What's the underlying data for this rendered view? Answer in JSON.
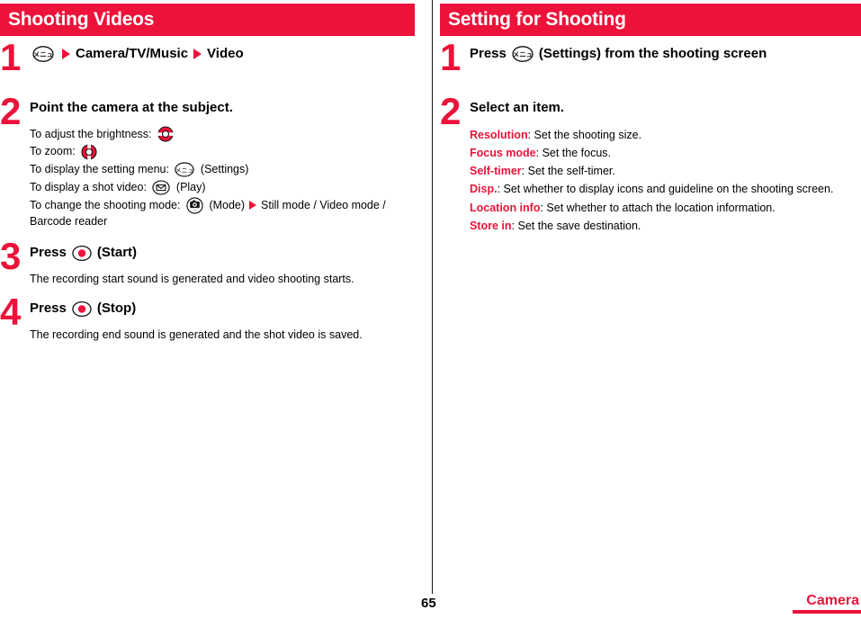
{
  "theme": {
    "accent": "#ec1239",
    "text": "#000000",
    "header_text": "#ffffff"
  },
  "left": {
    "header": "Shooting Videos",
    "step1": {
      "number": "1",
      "icon": "menu-key-icon",
      "sep": "▶",
      "text_a": "Camera/TV/Music",
      "text_b": "Video"
    },
    "step2": {
      "number": "2",
      "title": "Point the camera at the subject.",
      "lines": [
        {
          "label": "To adjust the brightness: ",
          "icon": "updown-key-icon",
          "suffix": ""
        },
        {
          "label": "To zoom: ",
          "icon": "leftright-key-icon",
          "suffix": ""
        },
        {
          "label": "To display the setting menu: ",
          "icon": "menu-key-icon",
          "suffix": " (Settings)"
        },
        {
          "label": "To display a shot video: ",
          "icon": "mail-key-icon",
          "suffix": " (Play)"
        },
        {
          "label": "To change the shooting mode: ",
          "icon": "camera-key-icon",
          "suffix": " (Mode)",
          "after_arrow": "Still mode / Video mode /"
        }
      ],
      "wrap_text": "Barcode reader"
    },
    "step3": {
      "number": "3",
      "title_prefix": "Press",
      "icon": "center-key-icon",
      "title_suffix": "(Start)",
      "body": "The recording start sound is generated and video shooting starts."
    },
    "step4": {
      "number": "4",
      "title_prefix": "Press",
      "icon": "center-key-icon",
      "title_suffix": "(Stop)",
      "body": "The recording end sound is generated and the shot video is saved."
    }
  },
  "right": {
    "header": "Setting for Shooting",
    "step1": {
      "number": "1",
      "title_prefix": "Press",
      "icon": "menu-key-icon",
      "title_suffix": "(Settings) from the shooting screen"
    },
    "step2": {
      "number": "2",
      "title": "Select an item.",
      "items": [
        {
          "key": "Resolution",
          "desc": ": Set the shooting size."
        },
        {
          "key": "Focus mode",
          "desc": ": Set the focus."
        },
        {
          "key": "Self-timer",
          "desc": ": Set the self-timer."
        },
        {
          "key": "Disp.",
          "desc": ": Set whether to display icons and guideline on the shooting screen."
        },
        {
          "key": "Location info",
          "desc": ": Set whether to attach the location information."
        },
        {
          "key": "Store in",
          "desc": ": Set the save destination."
        }
      ]
    }
  },
  "footer": {
    "page_number": "65",
    "chapter": "Camera"
  }
}
